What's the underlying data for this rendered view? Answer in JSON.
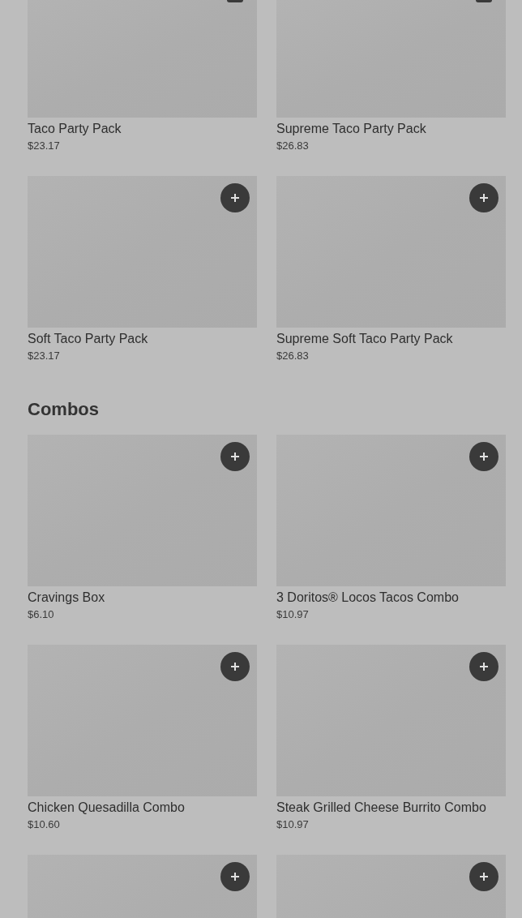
{
  "sections": [
    {
      "items": [
        {
          "kind": "card",
          "name": "Taco Party Pack",
          "price": "$23.17"
        },
        {
          "kind": "card",
          "name": "Supreme Taco Party Pack",
          "price": "$26.83"
        },
        {
          "kind": "card",
          "name": "Soft Taco Party Pack",
          "price": "$23.17"
        },
        {
          "kind": "card",
          "name": "Supreme Soft Taco Party Pack",
          "price": "$26.83"
        }
      ]
    },
    {
      "title": "Combos",
      "items": [
        {
          "kind": "card",
          "name": "Cravings Box",
          "price": "$6.10"
        },
        {
          "kind": "card",
          "name": "3 Doritos® Locos Tacos Combo",
          "price": "$10.97"
        },
        {
          "kind": "card",
          "name": "Chicken Quesadilla Combo",
          "price": "$10.60"
        },
        {
          "kind": "card",
          "name": "Steak Grilled Cheese Burrito Combo",
          "price": "$10.97"
        },
        {
          "kind": "card"
        },
        {
          "kind": "card"
        }
      ]
    }
  ]
}
